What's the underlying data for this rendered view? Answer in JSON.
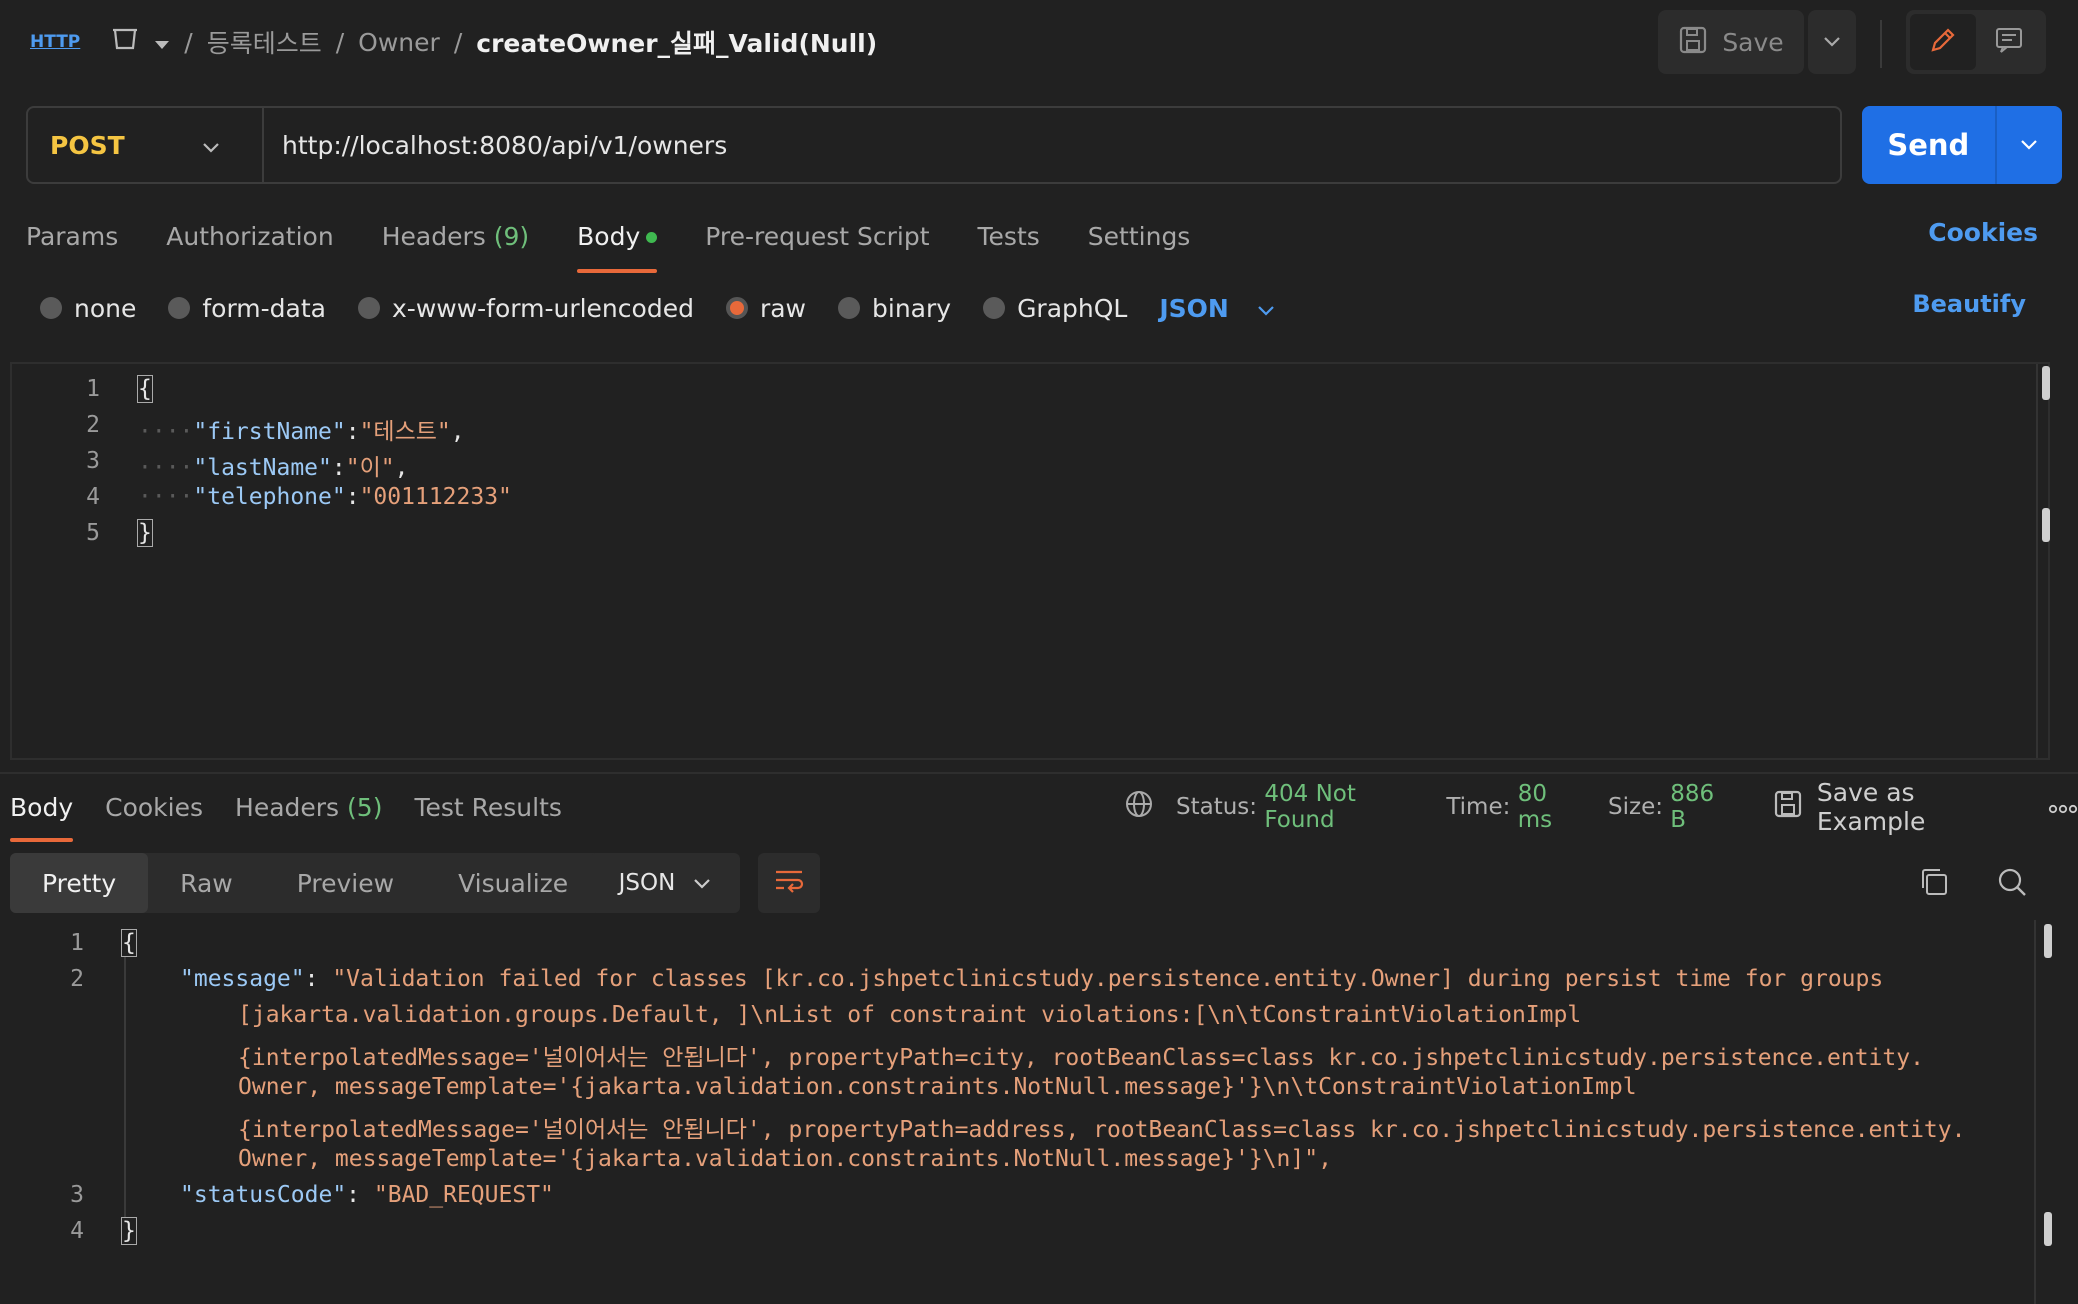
{
  "breadcrumb": {
    "icon": "HTTP",
    "collection": "등록테스트",
    "folder": "Owner",
    "request": "createOwner_실패_Valid(Null)",
    "sep": "/"
  },
  "toolbar": {
    "save_label": "Save"
  },
  "request": {
    "method": "POST",
    "url": "http://localhost:8080/api/v1/owners",
    "send_label": "Send"
  },
  "req_tabs": {
    "params": "Params",
    "authorization": "Authorization",
    "headers": "Headers",
    "headers_count": "(9)",
    "body": "Body",
    "pre_request": "Pre-request Script",
    "tests": "Tests",
    "settings": "Settings",
    "cookies": "Cookies"
  },
  "body_types": {
    "none": "none",
    "form_data": "form-data",
    "urlencoded": "x-www-form-urlencoded",
    "raw": "raw",
    "binary": "binary",
    "graphql": "GraphQL",
    "format": "JSON",
    "beautify": "Beautify"
  },
  "req_body": {
    "line_numbers": [
      "1",
      "2",
      "3",
      "4",
      "5"
    ],
    "open": "{",
    "close": "}",
    "fields": [
      {
        "key": "\"firstName\"",
        "value": "\"테스트\"",
        "trail": ","
      },
      {
        "key": "\"lastName\"",
        "value": "\"이\"",
        "trail": ","
      },
      {
        "key": "\"telephone\"",
        "value": "\"001112233\"",
        "trail": ""
      }
    ]
  },
  "res_tabs": {
    "body": "Body",
    "cookies": "Cookies",
    "headers": "Headers",
    "headers_count": "(5)",
    "test_results": "Test Results"
  },
  "status": {
    "status_label": "Status:",
    "status_value": "404 Not Found",
    "time_label": "Time:",
    "time_value": "80 ms",
    "size_label": "Size:",
    "size_value": "886 B",
    "save_example": "Save as Example"
  },
  "views": {
    "pretty": "Pretty",
    "raw": "Raw",
    "preview": "Preview",
    "visualize": "Visualize",
    "format": "JSON"
  },
  "res_body": {
    "line_numbers": [
      "1",
      "2",
      "3",
      "4"
    ],
    "open": "{",
    "close": "}",
    "message_key": "\"message\"",
    "message_lines": [
      "\"Validation failed for classes [kr.co.jshpetclinicstudy.persistence.entity.Owner] during persist time for groups",
      "[jakarta.validation.groups.Default, ]\\nList of constraint violations:[\\n\\tConstraintViolationImpl",
      "{interpolatedMessage='널이어서는 안됩니다', propertyPath=city, rootBeanClass=class kr.co.jshpetclinicstudy.persistence.entity.",
      "Owner, messageTemplate='{jakarta.validation.constraints.NotNull.message}'}\\n\\tConstraintViolationImpl",
      "{interpolatedMessage='널이어서는 안됩니다', propertyPath=address, rootBeanClass=class kr.co.jshpetclinicstudy.persistence.entity.",
      "Owner, messageTemplate='{jakarta.validation.constraints.NotNull.message}'}\\n]\","
    ],
    "status_key": "\"statusCode\"",
    "status_value": "\"BAD_REQUEST\""
  }
}
